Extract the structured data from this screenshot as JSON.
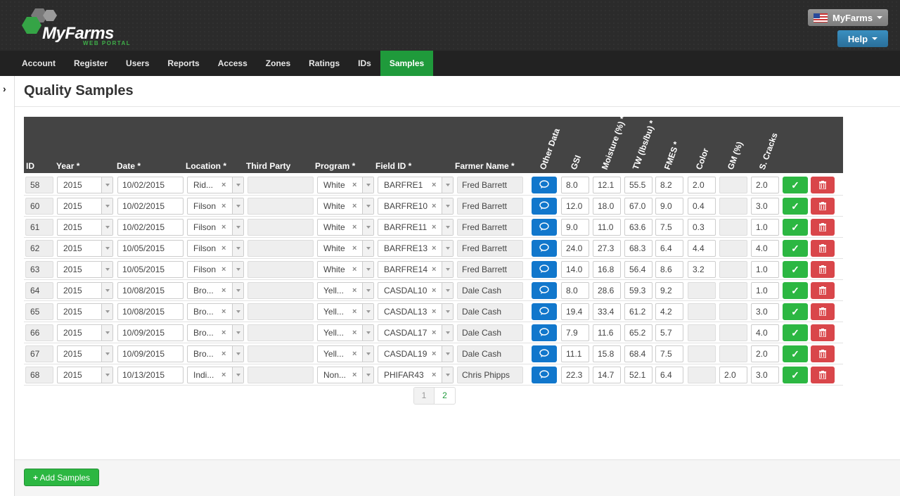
{
  "brand": {
    "name": "MyFarms",
    "subtitle": "WEB PORTAL"
  },
  "header": {
    "account_menu": "MyFarms",
    "help_menu": "Help"
  },
  "nav": [
    "Account",
    "Register",
    "Users",
    "Reports",
    "Access",
    "Zones",
    "Ratings",
    "IDs",
    "Samples"
  ],
  "nav_active": "Samples",
  "page_title": "Quality Samples",
  "columns": {
    "id": "ID",
    "year": "Year *",
    "date": "Date *",
    "location": "Location *",
    "third_party": "Third Party",
    "program": "Program *",
    "field_id": "Field ID *",
    "farmer_name": "Farmer Name *",
    "other_data": "Other Data",
    "gsi": "GSI",
    "moisture": "Moisture (%) *",
    "tw": "TW (lbs/bu) *",
    "fmes": "FMES *",
    "color": "Color",
    "gm": "GM (%)",
    "s_cracks": "S. Cracks"
  },
  "rows": [
    {
      "id": "58",
      "year": "2015",
      "date": "10/02/2015",
      "location": "Rid...",
      "third_party": "",
      "program": "White",
      "field_id": "BARFRE1",
      "farmer": "Fred Barrett",
      "gsi": "8.0",
      "moisture": "12.1",
      "tw": "55.5",
      "fmes": "8.2",
      "color": "2.0",
      "gm": "",
      "s_cracks": "2.0"
    },
    {
      "id": "60",
      "year": "2015",
      "date": "10/02/2015",
      "location": "Filson",
      "third_party": "",
      "program": "White",
      "field_id": "BARFRE10",
      "farmer": "Fred Barrett",
      "gsi": "12.0",
      "moisture": "18.0",
      "tw": "67.0",
      "fmes": "9.0",
      "color": "0.4",
      "gm": "",
      "s_cracks": "3.0"
    },
    {
      "id": "61",
      "year": "2015",
      "date": "10/02/2015",
      "location": "Filson",
      "third_party": "",
      "program": "White",
      "field_id": "BARFRE11",
      "farmer": "Fred Barrett",
      "gsi": "9.0",
      "moisture": "11.0",
      "tw": "63.6",
      "fmes": "7.5",
      "color": "0.3",
      "gm": "",
      "s_cracks": "1.0"
    },
    {
      "id": "62",
      "year": "2015",
      "date": "10/05/2015",
      "location": "Filson",
      "third_party": "",
      "program": "White",
      "field_id": "BARFRE13",
      "farmer": "Fred Barrett",
      "gsi": "24.0",
      "moisture": "27.3",
      "tw": "68.3",
      "fmes": "6.4",
      "color": "4.4",
      "gm": "",
      "s_cracks": "4.0"
    },
    {
      "id": "63",
      "year": "2015",
      "date": "10/05/2015",
      "location": "Filson",
      "third_party": "",
      "program": "White",
      "field_id": "BARFRE14",
      "farmer": "Fred Barrett",
      "gsi": "14.0",
      "moisture": "16.8",
      "tw": "56.4",
      "fmes": "8.6",
      "color": "3.2",
      "gm": "",
      "s_cracks": "1.0"
    },
    {
      "id": "64",
      "year": "2015",
      "date": "10/08/2015",
      "location": "Bro...",
      "third_party": "",
      "program": "Yell...",
      "field_id": "CASDAL10",
      "farmer": "Dale Cash",
      "gsi": "8.0",
      "moisture": "28.6",
      "tw": "59.3",
      "fmes": "9.2",
      "color": "",
      "gm": "",
      "s_cracks": "1.0"
    },
    {
      "id": "65",
      "year": "2015",
      "date": "10/08/2015",
      "location": "Bro...",
      "third_party": "",
      "program": "Yell...",
      "field_id": "CASDAL13",
      "farmer": "Dale Cash",
      "gsi": "19.4",
      "moisture": "33.4",
      "tw": "61.2",
      "fmes": "4.2",
      "color": "",
      "gm": "",
      "s_cracks": "3.0"
    },
    {
      "id": "66",
      "year": "2015",
      "date": "10/09/2015",
      "location": "Bro...",
      "third_party": "",
      "program": "Yell...",
      "field_id": "CASDAL17",
      "farmer": "Dale Cash",
      "gsi": "7.9",
      "moisture": "11.6",
      "tw": "65.2",
      "fmes": "5.7",
      "color": "",
      "gm": "",
      "s_cracks": "4.0"
    },
    {
      "id": "67",
      "year": "2015",
      "date": "10/09/2015",
      "location": "Bro...",
      "third_party": "",
      "program": "Yell...",
      "field_id": "CASDAL19",
      "farmer": "Dale Cash",
      "gsi": "11.1",
      "moisture": "15.8",
      "tw": "68.4",
      "fmes": "7.5",
      "color": "",
      "gm": "",
      "s_cracks": "2.0"
    },
    {
      "id": "68",
      "year": "2015",
      "date": "10/13/2015",
      "location": "Indi...",
      "third_party": "",
      "program": "Non...",
      "field_id": "PHIFAR43",
      "farmer": "Chris Phipps",
      "gsi": "22.3",
      "moisture": "14.7",
      "tw": "52.1",
      "fmes": "6.4",
      "color": "",
      "gm": "2.0",
      "s_cracks": "3.0"
    }
  ],
  "pagination": {
    "pages": [
      "1",
      "2"
    ],
    "current": "1"
  },
  "add_button": "Add Samples",
  "colors": {
    "accent_green": "#2cb742",
    "nav_active": "#1f9a3b",
    "primary_blue": "#1177cc",
    "danger_red": "#d9464a",
    "header_dark": "#444444"
  },
  "icons": {
    "other_data": "comment-icon",
    "save": "check-icon",
    "delete": "trash-icon",
    "add": "plus-icon",
    "sidebar_toggle": "chevron-right-icon"
  }
}
